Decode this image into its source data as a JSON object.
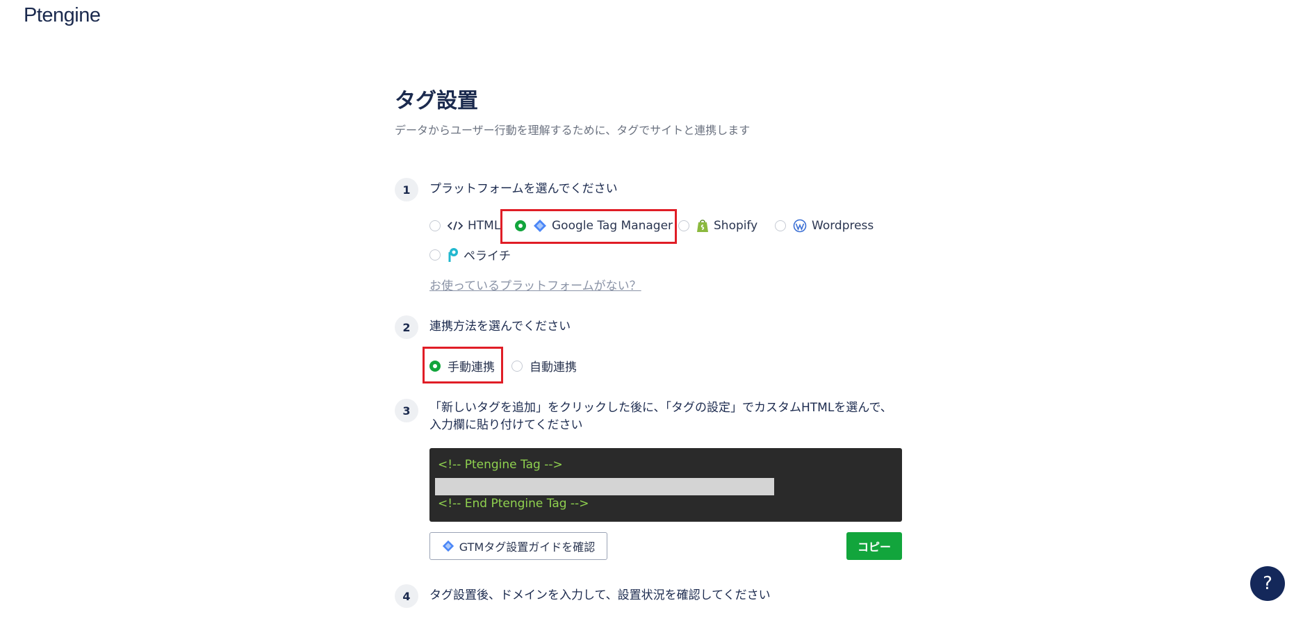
{
  "header": {
    "logo_text": "Ptengine"
  },
  "page": {
    "title": "タグ設置",
    "subtitle": "データからユーザー行動を理解するために、タグでサイトと連携します"
  },
  "steps": [
    {
      "number": "1",
      "title": "プラットフォームを選んでください",
      "options": [
        {
          "label": "HTML",
          "icon": "code-icon",
          "selected": false
        },
        {
          "label": "Google Tag Manager",
          "icon": "gtm-icon",
          "selected": true
        },
        {
          "label": "Shopify",
          "icon": "shopify-icon",
          "selected": false
        },
        {
          "label": "Wordpress",
          "icon": "wordpress-icon",
          "selected": false
        },
        {
          "label": "ペライチ",
          "icon": "peraichi-icon",
          "selected": false
        }
      ],
      "link": "お使っているプラットフォームがない？"
    },
    {
      "number": "2",
      "title": "連携方法を選んでください",
      "options": [
        {
          "label": "手動連携",
          "selected": true
        },
        {
          "label": "自動連携",
          "selected": false
        }
      ]
    },
    {
      "number": "3",
      "title": "「新しいタグを追加」をクリックした後に、「タグの設定」でカスタムHTMLを選んで、入力欄に貼り付けてください",
      "code": {
        "line1": "<!-- Ptengine Tag -->",
        "line3": "<!-- End Ptengine Tag -->"
      },
      "guide_button": "GTMタグ設置ガイドを確認",
      "copy_button": "コピー"
    },
    {
      "number": "4",
      "title": "タグ設置後、ドメインを入力して、設置状況を確認してください"
    }
  ],
  "help_button": "?",
  "colors": {
    "accent_green": "#12a53c",
    "highlight_red": "#e01d26",
    "navy": "#1b2a4e"
  }
}
